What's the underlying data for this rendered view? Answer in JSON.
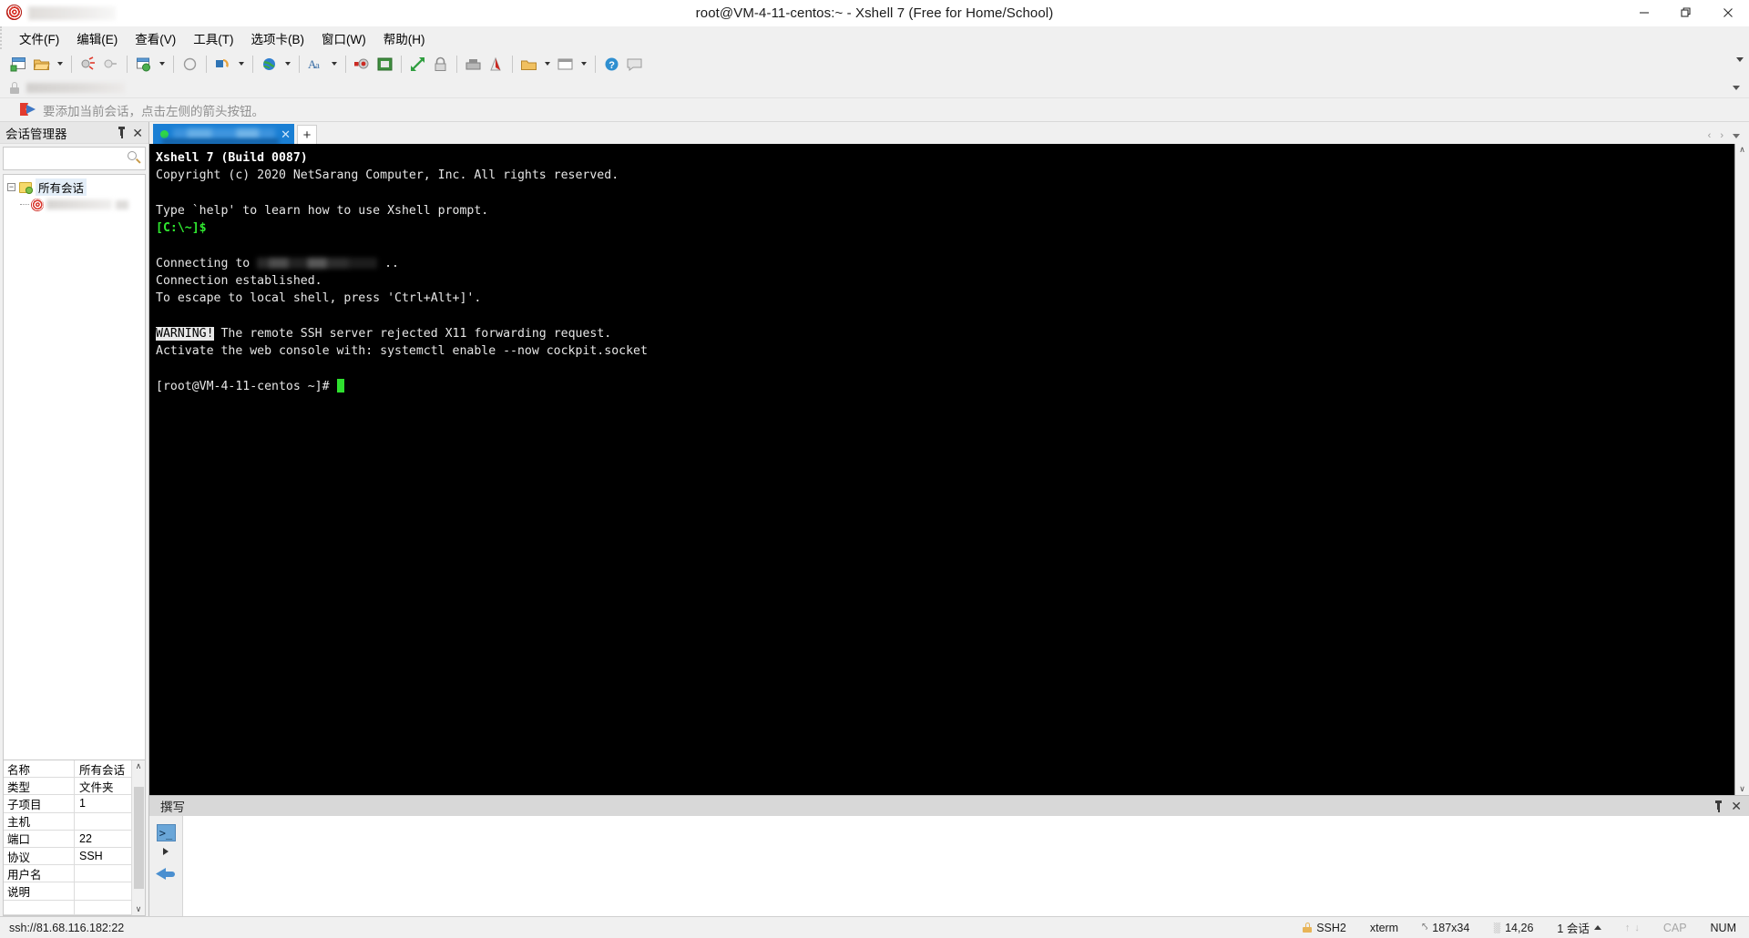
{
  "window": {
    "title": "root@VM-4-11-centos:~ - Xshell 7 (Free for Home/School)",
    "minimize_label": "—",
    "restore_label": "❐",
    "close_label": "✕"
  },
  "menu": {
    "items": [
      {
        "label": "文件(F)",
        "name": "menu-file"
      },
      {
        "label": "编辑(E)",
        "name": "menu-edit"
      },
      {
        "label": "查看(V)",
        "name": "menu-view"
      },
      {
        "label": "工具(T)",
        "name": "menu-tools"
      },
      {
        "label": "选项卡(B)",
        "name": "menu-tabs"
      },
      {
        "label": "窗口(W)",
        "name": "menu-window"
      },
      {
        "label": "帮助(H)",
        "name": "menu-help"
      }
    ]
  },
  "toolbar": {
    "buttons": [
      {
        "name": "new-session-button",
        "icon": "new-file-icon"
      },
      {
        "name": "open-session-button",
        "icon": "open-folder-icon"
      },
      {
        "name": "open-session-dropdown",
        "icon": "chevron-down-icon"
      },
      {
        "name": "disconnect-button",
        "icon": "disconnect-icon"
      },
      {
        "name": "reconnect-button",
        "icon": "reconnect-icon"
      },
      {
        "name": "session-properties-button",
        "icon": "properties-icon"
      },
      {
        "name": "session-properties-dropdown",
        "icon": "chevron-down-icon"
      },
      {
        "name": "copy-status-button",
        "icon": "circle-icon"
      },
      {
        "name": "paste-button",
        "icon": "paste-icon"
      },
      {
        "name": "paste-dropdown",
        "icon": "chevron-down-icon"
      },
      {
        "name": "web-browser-button",
        "icon": "globe-icon"
      },
      {
        "name": "web-browser-dropdown",
        "icon": "chevron-down-icon"
      },
      {
        "name": "font-button",
        "icon": "font-icon"
      },
      {
        "name": "font-dropdown",
        "icon": "chevron-down-icon"
      },
      {
        "name": "record-button",
        "icon": "record-icon"
      },
      {
        "name": "log-button",
        "icon": "log-icon"
      },
      {
        "name": "arrange-button",
        "icon": "arrange-icon"
      },
      {
        "name": "lock-button",
        "icon": "lock-icon"
      },
      {
        "name": "transfer-button",
        "icon": "transfer-icon"
      },
      {
        "name": "sftp-button",
        "icon": "sftp-icon"
      },
      {
        "name": "tunnel-button",
        "icon": "tunnel-icon"
      },
      {
        "name": "tunnel-dropdown",
        "icon": "chevron-down-icon"
      },
      {
        "name": "highlight-button",
        "icon": "highlight-icon"
      },
      {
        "name": "highlight-dropdown",
        "icon": "chevron-down-icon"
      },
      {
        "name": "help-button",
        "icon": "help-icon"
      },
      {
        "name": "feedback-button",
        "icon": "comment-icon"
      }
    ],
    "overflow_label": "▼"
  },
  "address_bar": {
    "value": "",
    "lock_icon": "lock-icon",
    "dropdown_icon": "chevron-down-icon"
  },
  "tip_bar": {
    "text": "要添加当前会话，点击左侧的箭头按钮。",
    "icon": "flag-arrow-icon"
  },
  "session_manager": {
    "title": "会话管理器",
    "pin_label": "⚐",
    "close_label": "✕",
    "search": {
      "value": "",
      "placeholder": ""
    },
    "tree": {
      "toggle": "−",
      "root_label": "所有会话",
      "child_label": ""
    },
    "properties": {
      "rows": [
        {
          "key": "名称",
          "value": "所有会话"
        },
        {
          "key": "类型",
          "value": "文件夹"
        },
        {
          "key": "子项目",
          "value": "1"
        },
        {
          "key": "主机",
          "value": ""
        },
        {
          "key": "端口",
          "value": "22"
        },
        {
          "key": "协议",
          "value": "SSH"
        },
        {
          "key": "用户名",
          "value": ""
        },
        {
          "key": "说明",
          "value": ""
        }
      ],
      "scroll_up": "∧",
      "scroll_down": "∨"
    }
  },
  "tabs": {
    "active": {
      "label": "",
      "status_icon": "connected-dot-icon",
      "close_label": "✕"
    },
    "new_tab_label": "+",
    "nav_prev": "‹",
    "nav_next": "›",
    "nav_list": "▾"
  },
  "terminal": {
    "lines": [
      {
        "segments": [
          {
            "text": "Xshell 7 (Build 0087)",
            "style": "bold"
          }
        ]
      },
      {
        "segments": [
          {
            "text": "Copyright (c) 2020 NetSarang Computer, Inc. All rights reserved.",
            "style": "plain"
          }
        ]
      },
      {
        "segments": [
          {
            "text": "",
            "style": "plain"
          }
        ]
      },
      {
        "segments": [
          {
            "text": "Type `help' to learn how to use Xshell prompt.",
            "style": "plain"
          }
        ]
      },
      {
        "segments": [
          {
            "text": "[C:\\~]$",
            "style": "green-bold"
          }
        ]
      },
      {
        "segments": [
          {
            "text": "",
            "style": "plain"
          }
        ]
      },
      {
        "segments": [
          {
            "text": "Connecting to ",
            "style": "plain"
          },
          {
            "text": "",
            "style": "blur"
          },
          {
            "text": " ..",
            "style": "plain"
          }
        ]
      },
      {
        "segments": [
          {
            "text": "Connection established.",
            "style": "plain"
          }
        ]
      },
      {
        "segments": [
          {
            "text": "To escape to local shell, press 'Ctrl+Alt+]'.",
            "style": "plain"
          }
        ]
      },
      {
        "segments": [
          {
            "text": "",
            "style": "plain"
          }
        ]
      },
      {
        "segments": [
          {
            "text": "WARNING!",
            "style": "inverse"
          },
          {
            "text": " The remote SSH server rejected X11 forwarding request.",
            "style": "plain"
          }
        ]
      },
      {
        "segments": [
          {
            "text": "Activate the web console with: systemctl enable --now cockpit.socket",
            "style": "plain"
          }
        ]
      },
      {
        "segments": [
          {
            "text": "",
            "style": "plain"
          }
        ]
      },
      {
        "segments": [
          {
            "text": "[root@VM-4-11-centos ~]# ",
            "style": "plain"
          },
          {
            "text": "",
            "style": "cursor"
          }
        ]
      }
    ],
    "scroll_up": "∧",
    "scroll_down": "∨"
  },
  "compose": {
    "title": "撰写",
    "pin_label": "⚐",
    "close_label": "✕",
    "prompt_icon_label": ">_",
    "expand_icon": "triangle-right-icon",
    "send_icon": "back-arrow-icon",
    "input_value": "",
    "input_placeholder": ""
  },
  "status_bar": {
    "connection": "ssh://81.68.116.182:22",
    "protocol": "SSH2",
    "terminal_type": "xterm",
    "size": "187x34",
    "cursor_position": "14,26",
    "session_count": "1 会话",
    "caps": "CAP",
    "num": "NUM",
    "lock_icon": "lock-icon",
    "size_icon": "screen-size-icon",
    "cursor_icon": "cursor-position-icon",
    "session_caret": "▲",
    "upload_icon": "↑",
    "download_icon": "↓"
  }
}
